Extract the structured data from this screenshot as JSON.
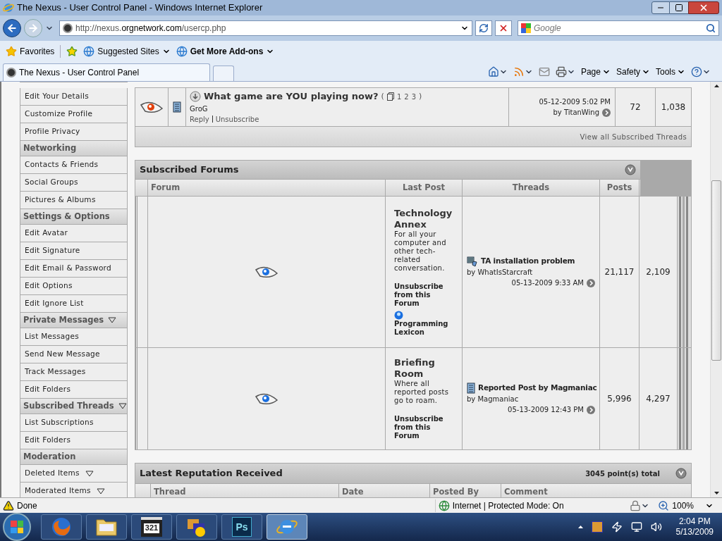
{
  "window": {
    "title": "The Nexus - User Control Panel - Windows Internet Explorer"
  },
  "address_bar": {
    "url_prefix": "http://nexus.",
    "url_domain": "orgnetwork.com",
    "url_path": "/usercp.php"
  },
  "search": {
    "placeholder": "Google"
  },
  "favorites_bar": {
    "favorites": "Favorites",
    "items": [
      {
        "label": "Suggested Sites",
        "bold": false
      },
      {
        "label": "Get More Add-ons",
        "bold": true
      }
    ]
  },
  "tab": {
    "title": "The Nexus - User Control Panel"
  },
  "command_bar": {
    "menus": [
      "Page",
      "Safety",
      "Tools"
    ]
  },
  "sidebar": {
    "items": [
      {
        "kind": "link",
        "label": "Edit Your Details",
        "dropdown": false
      },
      {
        "kind": "link",
        "label": "Customize Profile",
        "dropdown": false
      },
      {
        "kind": "link",
        "label": "Profile Privacy",
        "dropdown": false
      },
      {
        "kind": "header",
        "label": "Networking",
        "dropdown": false
      },
      {
        "kind": "link",
        "label": "Contacts & Friends",
        "dropdown": false
      },
      {
        "kind": "link",
        "label": "Social Groups",
        "dropdown": false
      },
      {
        "kind": "link",
        "label": "Pictures & Albums",
        "dropdown": false
      },
      {
        "kind": "header",
        "label": "Settings & Options",
        "dropdown": false
      },
      {
        "kind": "link",
        "label": "Edit Avatar",
        "dropdown": false
      },
      {
        "kind": "link",
        "label": "Edit Signature",
        "dropdown": false
      },
      {
        "kind": "link",
        "label": "Edit Email & Password",
        "dropdown": false
      },
      {
        "kind": "link",
        "label": "Edit Options",
        "dropdown": false
      },
      {
        "kind": "link",
        "label": "Edit Ignore List",
        "dropdown": false
      },
      {
        "kind": "header",
        "label": "Private Messages",
        "dropdown": true
      },
      {
        "kind": "link",
        "label": "List Messages",
        "dropdown": false
      },
      {
        "kind": "link",
        "label": "Send New Message",
        "dropdown": false
      },
      {
        "kind": "link",
        "label": "Track Messages",
        "dropdown": false
      },
      {
        "kind": "link",
        "label": "Edit Folders",
        "dropdown": false
      },
      {
        "kind": "header",
        "label": "Subscribed Threads",
        "dropdown": true
      },
      {
        "kind": "link",
        "label": "List Subscriptions",
        "dropdown": false
      },
      {
        "kind": "link",
        "label": "Edit Folders",
        "dropdown": false
      },
      {
        "kind": "header",
        "label": "Moderation",
        "dropdown": false
      },
      {
        "kind": "link",
        "label": "Deleted Items",
        "dropdown": true
      },
      {
        "kind": "link",
        "label": "Moderated Items",
        "dropdown": true
      }
    ]
  },
  "subscribed_threads": {
    "rows": [
      {
        "title": "What game are YOU playing now?",
        "pages_open": "(",
        "pages": [
          "1",
          "2",
          "3"
        ],
        "pages_close": ")",
        "author": "GroG",
        "actions": [
          "Reply",
          "Unsubscribe"
        ],
        "last_post_date": "05-12-2009 5:02 PM",
        "last_post_by": "by TitanWing",
        "replies": "72",
        "views": "1,038"
      }
    ],
    "footer_link": "View all Subscribed Threads"
  },
  "subscribed_forums": {
    "title": "Subscribed Forums",
    "columns": [
      "Forum",
      "Last Post",
      "Threads",
      "Posts"
    ],
    "rows": [
      {
        "name": "Technology Annex",
        "description": "For all your computer and other tech-related conversation.",
        "unsubscribe": "Unsubscribe from this Forum",
        "subforum": "Programming Lexicon",
        "last_post_title": "TA installation problem",
        "kind": "people",
        "last_post_by": "by WhatIsStarcraft",
        "last_post_date": "05-13-2009 9:33 AM",
        "threads": "21,117",
        "posts": "2,109"
      },
      {
        "name": "Briefing Room",
        "description": "Where all reported posts go to roam.",
        "unsubscribe": "Unsubscribe from this Forum",
        "last_post_title": "Reported Post by Magmaniac",
        "kind": "document",
        "last_post_by": "by Magmaniac",
        "last_post_date": "05-13-2009 12:43 PM",
        "threads": "5,996",
        "posts": "4,297"
      }
    ]
  },
  "reputation": {
    "title": "Latest Reputation Received",
    "total": "3045 point(s) total",
    "columns": [
      "Thread",
      "Date",
      "Posted By",
      "Comment"
    ]
  },
  "status_bar": {
    "status": "Done",
    "zone": "Internet | Protected Mode: On",
    "zoom": "100%"
  },
  "taskbar": {
    "apps": [
      {
        "kind": "firefox",
        "selected": false
      },
      {
        "kind": "folder",
        "selected": false
      },
      {
        "kind": "media",
        "label": "321",
        "selected": false
      },
      {
        "kind": "chat",
        "selected": false
      },
      {
        "kind": "photoshop",
        "label": "Ps",
        "selected": false
      },
      {
        "kind": "ie",
        "selected": true
      }
    ],
    "time": "2:04 PM",
    "date": "5/13/2009"
  }
}
